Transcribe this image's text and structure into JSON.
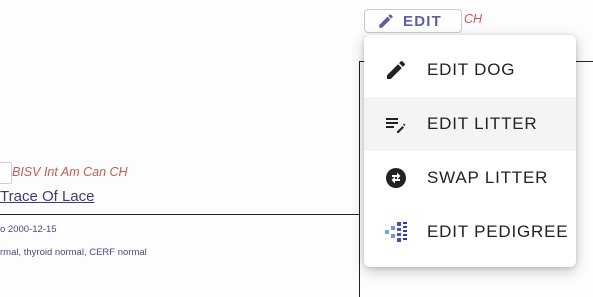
{
  "background": {
    "titles_text": "BISV Int Am Can CH",
    "dog_link": "Trace Of Lace",
    "date_text": "o 2000-12-15",
    "health_text": "rmal, thyroid normal, CERF normal"
  },
  "edit_button": {
    "label": "EDIT",
    "icon": "pencil-icon",
    "trailing_text": "CH"
  },
  "menu": {
    "items": [
      {
        "label": "EDIT DOG",
        "icon": "pencil-icon"
      },
      {
        "label": "EDIT LITTER",
        "icon": "list-edit-icon"
      },
      {
        "label": "SWAP LITTER",
        "icon": "swap-icon"
      },
      {
        "label": "EDIT PEDIGREE",
        "icon": "pedigree-icon"
      }
    ]
  },
  "colors": {
    "accent": "#5b5fa8",
    "title_red": "#c25b56",
    "link": "#3f3a7a",
    "pedigree_teal": "#5fb8c8",
    "pedigree_blue": "#3b4fd1"
  }
}
